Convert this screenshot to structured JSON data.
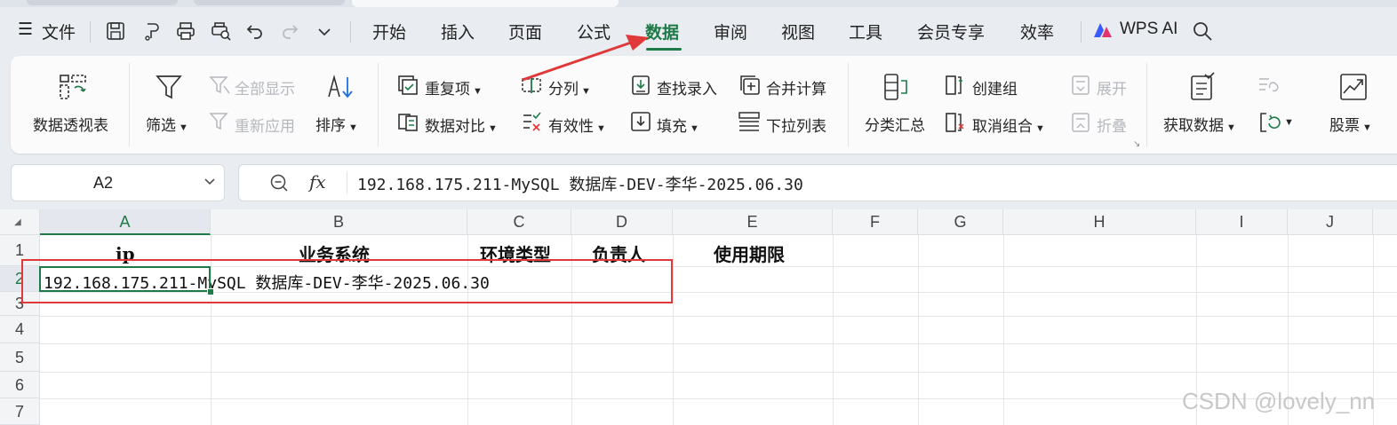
{
  "menubar": {
    "file_label": "文件",
    "tabs": [
      "开始",
      "插入",
      "页面",
      "公式",
      "数据",
      "审阅",
      "视图",
      "工具",
      "会员专享",
      "效率"
    ],
    "active_tab": "数据",
    "wps_ai_label": "WPS AI"
  },
  "ribbon": {
    "pivot_table": "数据透视表",
    "filter": "筛选",
    "show_all": "全部显示",
    "reapply": "重新应用",
    "sort": "排序",
    "duplicates": "重复项",
    "data_compare": "数据对比",
    "split_column": "分列",
    "validity": "有效性",
    "lookup_entry": "查找录入",
    "fill": "填充",
    "consolidate": "合并计算",
    "dropdown_list": "下拉列表",
    "subtotal": "分类汇总",
    "create_group": "创建组",
    "ungroup": "取消组合",
    "expand": "展开",
    "collapse": "折叠",
    "get_data": "获取数据",
    "stocks": "股票"
  },
  "formula_bar": {
    "name_box": "A2",
    "fx_label": "fx",
    "content": "192.168.175.211-MySQL 数据库-DEV-李华-2025.06.30"
  },
  "sheet": {
    "columns": [
      "A",
      "B",
      "C",
      "D",
      "E",
      "F",
      "G",
      "H",
      "I",
      "J"
    ],
    "rows": [
      "1",
      "2",
      "3",
      "4",
      "5",
      "6",
      "7"
    ],
    "selected_column": "A",
    "selected_row": "2",
    "headers": [
      "ip",
      "业务系统",
      "环境类型",
      "负责人",
      "使用期限"
    ],
    "a2_value": "192.168.175.211-MySQL 数据库-DEV-李华-2025.06.30"
  },
  "annotation": {
    "highlight_color": "#e0393a",
    "accent_color": "#1e7a46"
  },
  "watermark": "CSDN @lovely_nn"
}
